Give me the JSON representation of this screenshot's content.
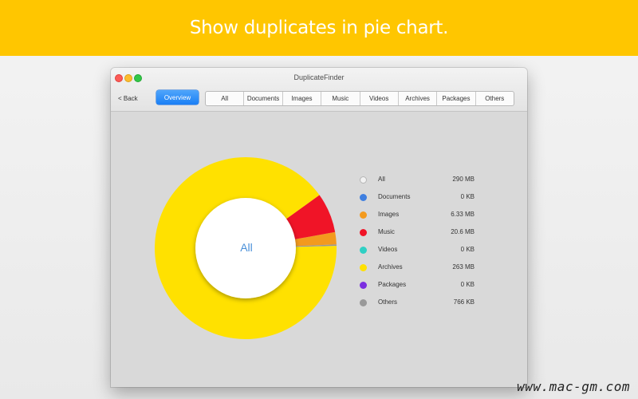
{
  "banner": {
    "text": "Show duplicates in pie chart."
  },
  "window": {
    "title": "DuplicateFinder"
  },
  "toolbar": {
    "back_label": "< Back",
    "overview_label": "Overview",
    "segments": [
      "All",
      "Documents",
      "Images",
      "Music",
      "Videos",
      "Archives",
      "Packages",
      "Others"
    ]
  },
  "chart_data": {
    "type": "pie",
    "center_label": "All",
    "categories": [
      "All",
      "Documents",
      "Images",
      "Music",
      "Videos",
      "Archives",
      "Packages",
      "Others"
    ],
    "sizes": [
      "290 MB",
      "0 KB",
      "6.33 MB",
      "20.6 MB",
      "0 KB",
      "263 MB",
      "0 KB",
      "766 KB"
    ],
    "values": [
      290,
      0,
      6.33,
      20.6,
      0,
      263,
      0,
      0.766
    ],
    "colors": [
      "#ffffff",
      "#3f7fe0",
      "#f39a1e",
      "#f01427",
      "#2fd0c4",
      "#ffe100",
      "#7b2fe0",
      "#999999"
    ],
    "legend": "right"
  },
  "watermark": {
    "text": "www.mac-gm.com"
  }
}
